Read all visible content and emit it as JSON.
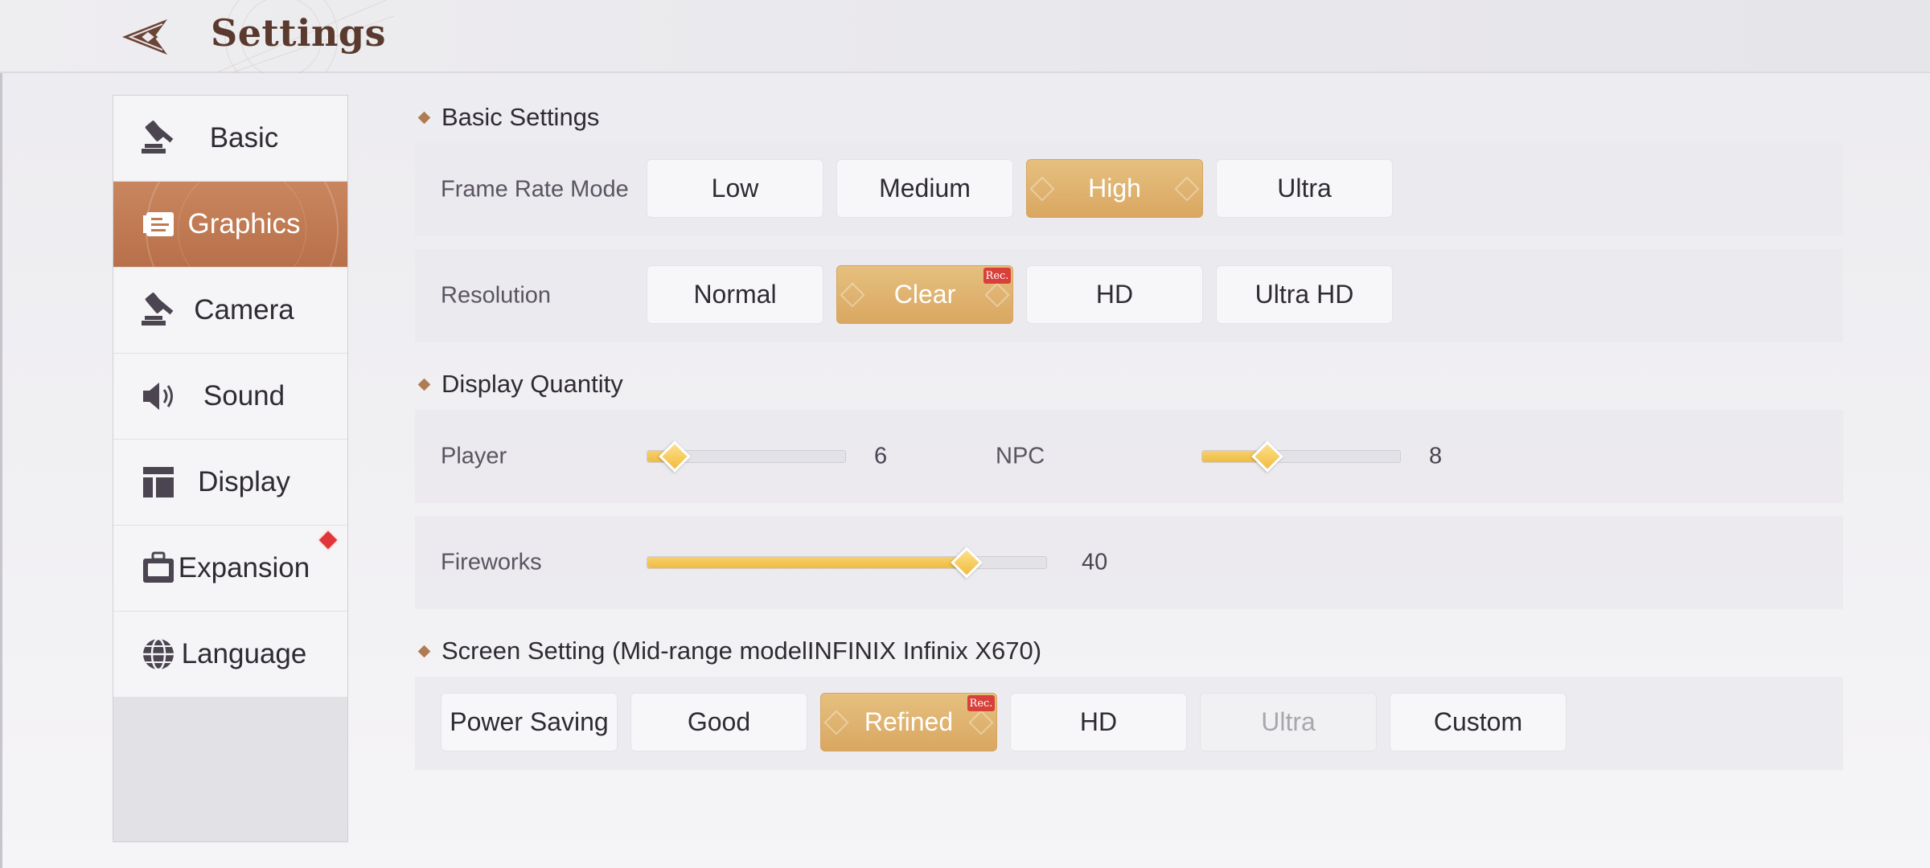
{
  "header": {
    "title": "Settings"
  },
  "sidebar": {
    "items": [
      {
        "label": "Basic",
        "icon": "gavel-icon",
        "active": false
      },
      {
        "label": "Graphics",
        "icon": "graphics-icon",
        "active": true
      },
      {
        "label": "Camera",
        "icon": "gavel-icon",
        "active": false
      },
      {
        "label": "Sound",
        "icon": "speaker-icon",
        "active": false
      },
      {
        "label": "Display",
        "icon": "layout-icon",
        "active": false
      },
      {
        "label": "Expansion",
        "icon": "briefcase-icon",
        "active": false,
        "badge": true
      },
      {
        "label": "Language",
        "icon": "globe-icon",
        "active": false
      }
    ]
  },
  "basic_settings": {
    "title": "Basic Settings",
    "frame_rate": {
      "label": "Frame Rate Mode",
      "options": [
        "Low",
        "Medium",
        "High",
        "Ultra"
      ],
      "selected": "High"
    },
    "resolution": {
      "label": "Resolution",
      "options": [
        "Normal",
        "Clear",
        "HD",
        "Ultra HD"
      ],
      "selected": "Clear",
      "recommended": "Clear"
    }
  },
  "display_quantity": {
    "title": "Display Quantity",
    "player": {
      "label": "Player",
      "value": "6",
      "fraction": 0.14
    },
    "npc": {
      "label": "NPC",
      "value": "8",
      "fraction": 0.33
    },
    "fireworks": {
      "label": "Fireworks",
      "value": "40",
      "fraction": 0.8
    }
  },
  "screen_setting": {
    "title": "Screen Setting (Mid-range modelINFINIX Infinix X670)",
    "options": [
      "Power Saving",
      "Good",
      "Refined",
      "HD",
      "Ultra",
      "Custom"
    ],
    "selected": "Refined",
    "recommended": "Refined",
    "disabled": "Ultra"
  },
  "badges": {
    "rec_label": "Rec."
  },
  "colors": {
    "accent": "#d9a761",
    "active_tab": "#c07a52",
    "badge_red": "#d8403a"
  }
}
